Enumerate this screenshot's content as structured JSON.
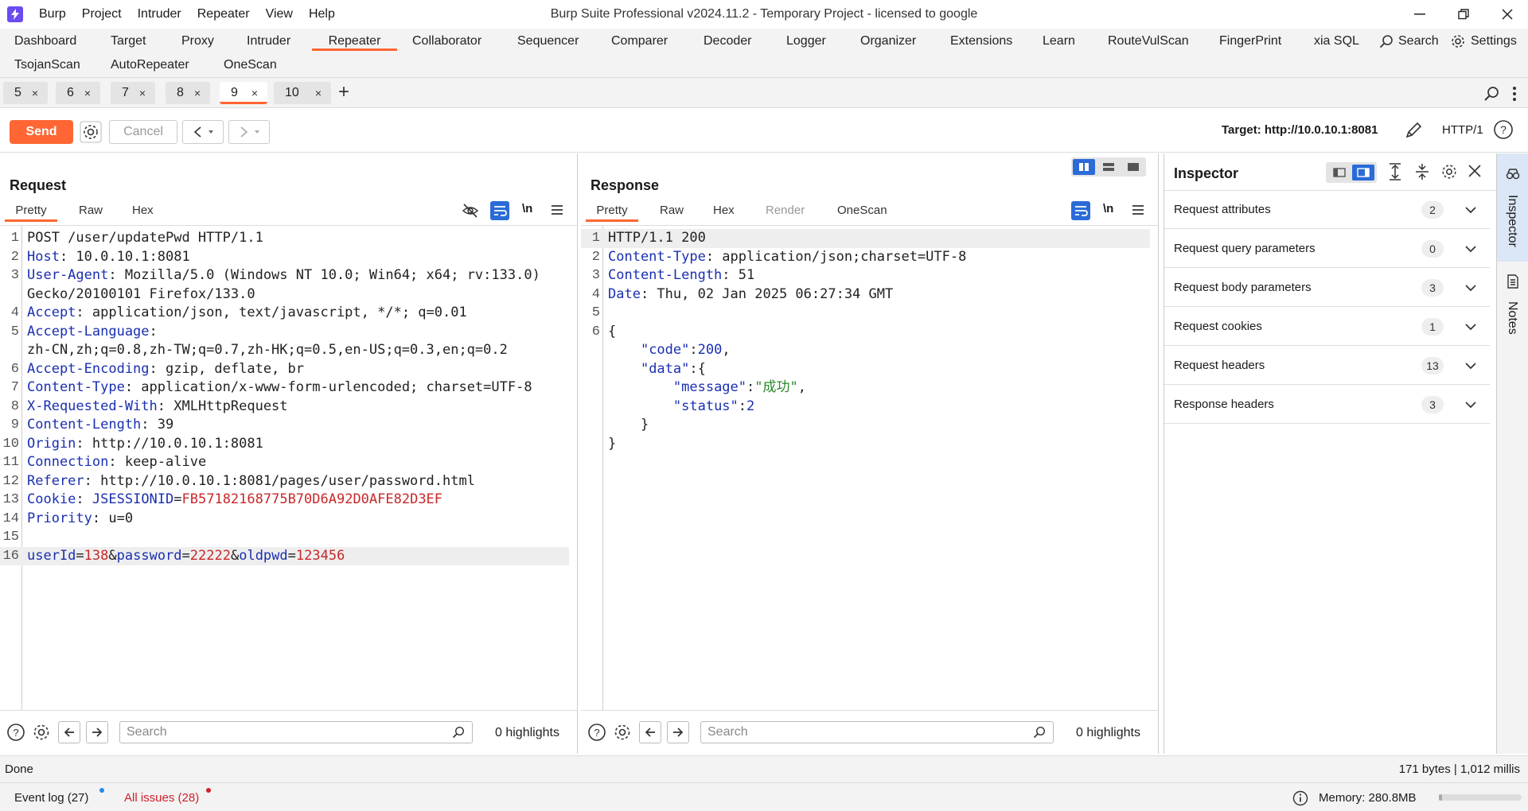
{
  "window": {
    "title": "Burp Suite Professional v2024.11.2 - Temporary Project - licensed to google",
    "menu": [
      "Burp",
      "Project",
      "Intruder",
      "Repeater",
      "View",
      "Help"
    ]
  },
  "tool_tabs": {
    "row1": [
      "Dashboard",
      "Target",
      "Proxy",
      "Intruder",
      "Repeater",
      "Collaborator",
      "Sequencer",
      "Comparer",
      "Decoder",
      "Logger",
      "Organizer",
      "Extensions",
      "Learn",
      "RouteVulScan",
      "FingerPrint",
      "xia SQL"
    ],
    "row2": [
      "TsojanScan",
      "AutoRepeater",
      "OneScan"
    ],
    "active": "Repeater",
    "search_label": "Search",
    "settings_label": "Settings"
  },
  "repeater_tabs": {
    "tabs": [
      "5",
      "6",
      "7",
      "8",
      "9",
      "10"
    ],
    "close_glyph": "×",
    "active": "9",
    "add_glyph": "+"
  },
  "toolbar": {
    "send_label": "Send",
    "cancel_label": "Cancel",
    "target_label": "Target: http://10.0.10.1:8081",
    "protocol_label": "HTTP/1"
  },
  "request": {
    "title": "Request",
    "tabs": [
      "Pretty",
      "Raw",
      "Hex"
    ],
    "active_tab": "Pretty",
    "lines": [
      {
        "n": "1",
        "parts": [
          {
            "t": "POST /user/updatePwd HTTP/1.1",
            "c": "val"
          }
        ]
      },
      {
        "n": "2",
        "parts": [
          {
            "t": "Host",
            "c": "hdr"
          },
          {
            "t": ": 10.0.10.1:8081",
            "c": "val"
          }
        ]
      },
      {
        "n": "3",
        "parts": [
          {
            "t": "User-Agent",
            "c": "hdr"
          },
          {
            "t": ": Mozilla/5.0 (Windows NT 10.0; Win64; x64; rv:133.0)",
            "c": "val"
          }
        ]
      },
      {
        "n": "",
        "parts": [
          {
            "t": "Gecko/20100101 Firefox/133.0",
            "c": "val"
          }
        ]
      },
      {
        "n": "4",
        "parts": [
          {
            "t": "Accept",
            "c": "hdr"
          },
          {
            "t": ": application/json, text/javascript, */*; q=0.01",
            "c": "val"
          }
        ]
      },
      {
        "n": "5",
        "parts": [
          {
            "t": "Accept-Language",
            "c": "hdr"
          },
          {
            "t": ":",
            "c": "val"
          }
        ]
      },
      {
        "n": "",
        "parts": [
          {
            "t": "zh-CN,zh;q=0.8,zh-TW;q=0.7,zh-HK;q=0.5,en-US;q=0.3,en;q=0.2",
            "c": "val"
          }
        ]
      },
      {
        "n": "6",
        "parts": [
          {
            "t": "Accept-Encoding",
            "c": "hdr"
          },
          {
            "t": ": gzip, deflate, br",
            "c": "val"
          }
        ]
      },
      {
        "n": "7",
        "parts": [
          {
            "t": "Content-Type",
            "c": "hdr"
          },
          {
            "t": ": application/x-www-form-urlencoded; charset=UTF-8",
            "c": "val"
          }
        ]
      },
      {
        "n": "8",
        "parts": [
          {
            "t": "X-Requested-With",
            "c": "hdr"
          },
          {
            "t": ": XMLHttpRequest",
            "c": "val"
          }
        ]
      },
      {
        "n": "9",
        "parts": [
          {
            "t": "Content-Length",
            "c": "hdr"
          },
          {
            "t": ": 39",
            "c": "val"
          }
        ]
      },
      {
        "n": "10",
        "parts": [
          {
            "t": "Origin",
            "c": "hdr"
          },
          {
            "t": ": http://10.0.10.1:8081",
            "c": "val"
          }
        ]
      },
      {
        "n": "11",
        "parts": [
          {
            "t": "Connection",
            "c": "hdr"
          },
          {
            "t": ": keep-alive",
            "c": "val"
          }
        ]
      },
      {
        "n": "12",
        "parts": [
          {
            "t": "Referer",
            "c": "hdr"
          },
          {
            "t": ": http://10.0.10.1:8081/pages/user/password.html",
            "c": "val"
          }
        ]
      },
      {
        "n": "13",
        "parts": [
          {
            "t": "Cookie",
            "c": "hdr"
          },
          {
            "t": ": ",
            "c": "val"
          },
          {
            "t": "JSESSIONID",
            "c": "blue"
          },
          {
            "t": "=",
            "c": "val"
          },
          {
            "t": "FB57182168775B70D6A92D0AFE82D3EF",
            "c": "red"
          }
        ]
      },
      {
        "n": "14",
        "parts": [
          {
            "t": "Priority",
            "c": "hdr"
          },
          {
            "t": ": u=0",
            "c": "val"
          }
        ]
      },
      {
        "n": "15",
        "parts": []
      },
      {
        "n": "16",
        "parts": [
          {
            "t": "userId",
            "c": "blue"
          },
          {
            "t": "=",
            "c": "val"
          },
          {
            "t": "138",
            "c": "red"
          },
          {
            "t": "&",
            "c": "val"
          },
          {
            "t": "password",
            "c": "blue"
          },
          {
            "t": "=",
            "c": "val"
          },
          {
            "t": "22222",
            "c": "red"
          },
          {
            "t": "&",
            "c": "val"
          },
          {
            "t": "oldpwd",
            "c": "blue"
          },
          {
            "t": "=",
            "c": "val"
          },
          {
            "t": "123456",
            "c": "red"
          }
        ]
      }
    ],
    "search_placeholder": "Search",
    "highlights": "0 highlights"
  },
  "response": {
    "title": "Response",
    "tabs": [
      "Pretty",
      "Raw",
      "Hex",
      "Render",
      "OneScan"
    ],
    "active_tab": "Pretty",
    "lines": [
      {
        "n": "1",
        "parts": [
          {
            "t": "HTTP/1.1 200",
            "c": "val"
          }
        ]
      },
      {
        "n": "2",
        "parts": [
          {
            "t": "Content-Type",
            "c": "hdr"
          },
          {
            "t": ": application/json;charset=UTF-8",
            "c": "val"
          }
        ]
      },
      {
        "n": "3",
        "parts": [
          {
            "t": "Content-Length",
            "c": "hdr"
          },
          {
            "t": ": 51",
            "c": "val"
          }
        ]
      },
      {
        "n": "4",
        "parts": [
          {
            "t": "Date",
            "c": "hdr"
          },
          {
            "t": ": Thu, 02 Jan 2025 06:27:34 GMT",
            "c": "val"
          }
        ]
      },
      {
        "n": "5",
        "parts": []
      },
      {
        "n": "6",
        "parts": [
          {
            "t": "{",
            "c": "val"
          }
        ]
      },
      {
        "n": "",
        "parts": [
          {
            "t": "    ",
            "c": "val"
          },
          {
            "t": "\"code\"",
            "c": "blue"
          },
          {
            "t": ":",
            "c": "val"
          },
          {
            "t": "200",
            "c": "blue"
          },
          {
            "t": ",",
            "c": "val"
          }
        ]
      },
      {
        "n": "",
        "parts": [
          {
            "t": "    ",
            "c": "val"
          },
          {
            "t": "\"data\"",
            "c": "blue"
          },
          {
            "t": ":{",
            "c": "val"
          }
        ]
      },
      {
        "n": "",
        "parts": [
          {
            "t": "        ",
            "c": "val"
          },
          {
            "t": "\"message\"",
            "c": "blue"
          },
          {
            "t": ":",
            "c": "val"
          },
          {
            "t": "\"成功\"",
            "c": "green"
          },
          {
            "t": ",",
            "c": "val"
          }
        ]
      },
      {
        "n": "",
        "parts": [
          {
            "t": "        ",
            "c": "val"
          },
          {
            "t": "\"status\"",
            "c": "blue"
          },
          {
            "t": ":",
            "c": "val"
          },
          {
            "t": "2",
            "c": "blue"
          }
        ]
      },
      {
        "n": "",
        "parts": [
          {
            "t": "    }",
            "c": "val"
          }
        ]
      },
      {
        "n": "",
        "parts": [
          {
            "t": "}",
            "c": "val"
          }
        ]
      }
    ],
    "search_placeholder": "Search",
    "highlights": "0 highlights"
  },
  "inspector": {
    "title": "Inspector",
    "rows": [
      {
        "label": "Request attributes",
        "count": "2"
      },
      {
        "label": "Request query parameters",
        "count": "0"
      },
      {
        "label": "Request body parameters",
        "count": "3"
      },
      {
        "label": "Request cookies",
        "count": "1"
      },
      {
        "label": "Request headers",
        "count": "13"
      },
      {
        "label": "Response headers",
        "count": "3"
      }
    ],
    "side_tabs": [
      "Inspector",
      "Notes"
    ]
  },
  "status": {
    "left": "Done",
    "right": "171 bytes | 1,012 millis"
  },
  "bottom": {
    "event_log": "Event log (27)",
    "all_issues": "All issues (28)",
    "memory": "Memory: 280.8MB"
  },
  "colors": {
    "accent": "#ff6633",
    "header_key": "#1a2fb0",
    "param_value": "#c8282a",
    "string_value": "#2a8a2a",
    "logo": "#6a4cf0"
  }
}
